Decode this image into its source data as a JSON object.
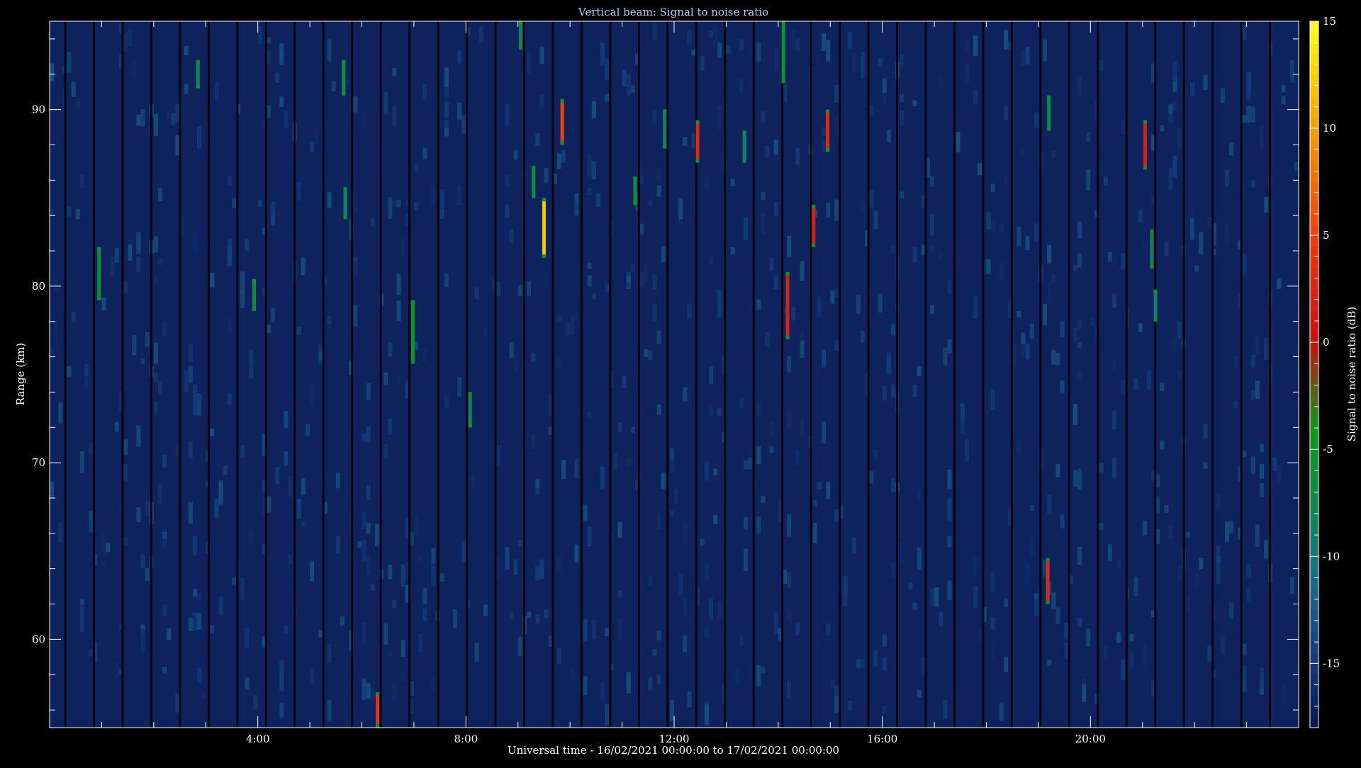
{
  "chart_data": {
    "type": "heatmap",
    "title": "Vertical beam: Signal to noise ratio",
    "xlabel": "Universal time - 16/02/2021 00:00:00 to 17/02/2021 00:00:00",
    "ylabel": "Range (km)",
    "colorbar_label": "Signal to noise ratio (dB)",
    "x_unit": "hours UT",
    "xlim": [
      0,
      24
    ],
    "ylim": [
      55,
      95
    ],
    "clim": [
      -18,
      15
    ],
    "x_ticks": [
      {
        "value": 4,
        "label": "4:00"
      },
      {
        "value": 8,
        "label": "8:00"
      },
      {
        "value": 12,
        "label": "12:00"
      },
      {
        "value": 16,
        "label": "16:00"
      },
      {
        "value": 20,
        "label": "20:00"
      }
    ],
    "y_ticks": [
      {
        "value": 60,
        "label": "60"
      },
      {
        "value": 70,
        "label": "70"
      },
      {
        "value": 80,
        "label": "80"
      },
      {
        "value": 90,
        "label": "90"
      }
    ],
    "colorbar_ticks": [
      {
        "value": 15,
        "label": "15"
      },
      {
        "value": 10,
        "label": "10"
      },
      {
        "value": 5,
        "label": "5"
      },
      {
        "value": 0,
        "label": "0"
      },
      {
        "value": -5,
        "label": "-5"
      },
      {
        "value": -10,
        "label": "-10"
      },
      {
        "value": -15,
        "label": "-15"
      }
    ],
    "colormap": [
      {
        "v": -18,
        "c": "#0c1650"
      },
      {
        "v": -15,
        "c": "#123a78"
      },
      {
        "v": -11,
        "c": "#1a6e8a"
      },
      {
        "v": -7,
        "c": "#0e8a4a"
      },
      {
        "v": -4,
        "c": "#0a9a18"
      },
      {
        "v": 0,
        "c": "#c81010"
      },
      {
        "v": 4,
        "c": "#e83010"
      },
      {
        "v": 8,
        "c": "#f07800"
      },
      {
        "v": 12,
        "c": "#f8c800"
      },
      {
        "v": 15,
        "c": "#ffff20"
      }
    ],
    "background_snr": -17,
    "echoes": [
      {
        "t": 0.95,
        "r0": 79.2,
        "r1": 82.2,
        "snr": -6
      },
      {
        "t": 2.85,
        "r0": 91.2,
        "r1": 92.8,
        "snr": -8
      },
      {
        "t": 3.93,
        "r0": 78.6,
        "r1": 80.4,
        "snr": -6
      },
      {
        "t": 5.65,
        "r0": 90.8,
        "r1": 92.8,
        "snr": -6
      },
      {
        "t": 5.68,
        "r0": 83.8,
        "r1": 85.6,
        "snr": -8
      },
      {
        "t": 6.3,
        "r0": 55.0,
        "r1": 57.0,
        "snr": 4
      },
      {
        "t": 6.98,
        "r0": 75.6,
        "r1": 79.2,
        "snr": -5
      },
      {
        "t": 8.08,
        "r0": 72.0,
        "r1": 74.0,
        "snr": -8
      },
      {
        "t": 9.05,
        "r0": 93.4,
        "r1": 95.0,
        "snr": -8
      },
      {
        "t": 9.3,
        "r0": 85.0,
        "r1": 86.8,
        "snr": -6
      },
      {
        "t": 9.5,
        "r0": 81.6,
        "r1": 85.0,
        "snr": 12
      },
      {
        "t": 9.85,
        "r0": 88.0,
        "r1": 90.6,
        "snr": 5
      },
      {
        "t": 11.25,
        "r0": 84.6,
        "r1": 86.2,
        "snr": -6
      },
      {
        "t": 11.82,
        "r0": 87.8,
        "r1": 90.0,
        "snr": -8
      },
      {
        "t": 12.45,
        "r0": 87.0,
        "r1": 89.4,
        "snr": 3
      },
      {
        "t": 13.35,
        "r0": 87.0,
        "r1": 88.8,
        "snr": -8
      },
      {
        "t": 14.1,
        "r0": 91.5,
        "r1": 95.0,
        "snr": -5
      },
      {
        "t": 14.18,
        "r0": 77.0,
        "r1": 80.8,
        "snr": 2
      },
      {
        "t": 14.68,
        "r0": 82.2,
        "r1": 84.6,
        "snr": 2
      },
      {
        "t": 14.95,
        "r0": 87.6,
        "r1": 90.0,
        "snr": 3
      },
      {
        "t": 19.2,
        "r0": 88.8,
        "r1": 90.8,
        "snr": -6
      },
      {
        "t": 19.18,
        "r0": 62.0,
        "r1": 64.6,
        "snr": 3
      },
      {
        "t": 21.05,
        "r0": 86.6,
        "r1": 89.4,
        "snr": 2
      },
      {
        "t": 21.18,
        "r0": 81.0,
        "r1": 83.2,
        "snr": -8
      },
      {
        "t": 21.25,
        "r0": 78.0,
        "r1": 79.8,
        "snr": -9
      }
    ]
  }
}
